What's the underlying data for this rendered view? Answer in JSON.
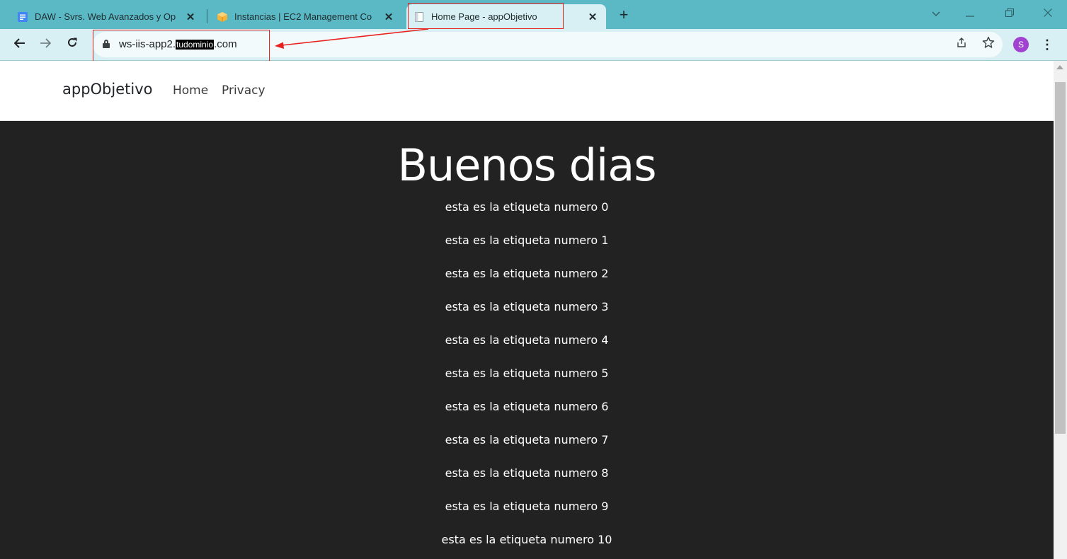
{
  "browser": {
    "tabs": [
      {
        "title": "DAW - Svrs. Web Avanzados y Op",
        "icon": "docs-icon",
        "active": false
      },
      {
        "title": "Instancias | EC2 Management Co",
        "icon": "aws-cube-icon",
        "active": false
      },
      {
        "title": "Home Page - appObjetivo",
        "icon": "page-icon",
        "active": true
      }
    ],
    "new_tab_label": "+",
    "close_label": "✕",
    "url": {
      "prefix": "ws-iis-app2.",
      "redacted": "tudominio",
      "suffix": ".com"
    },
    "profile_initial": "S",
    "colors": {
      "tabstrip": "#5bb9c6",
      "toolbar": "#d8f0f3",
      "profile": "#a142d1",
      "annotation": "#e8201e"
    }
  },
  "site": {
    "brand": "appObjetivo",
    "nav": [
      "Home",
      "Privacy"
    ],
    "heading": "Buenos dias",
    "labels": [
      "esta es la etiqueta numero 0",
      "esta es la etiqueta numero 1",
      "esta es la etiqueta numero 2",
      "esta es la etiqueta numero 3",
      "esta es la etiqueta numero 4",
      "esta es la etiqueta numero 5",
      "esta es la etiqueta numero 6",
      "esta es la etiqueta numero 7",
      "esta es la etiqueta numero 8",
      "esta es la etiqueta numero 9",
      "esta es la etiqueta numero 10"
    ],
    "colors": {
      "content_bg": "#222222",
      "nav_bg": "#ffffff"
    }
  }
}
